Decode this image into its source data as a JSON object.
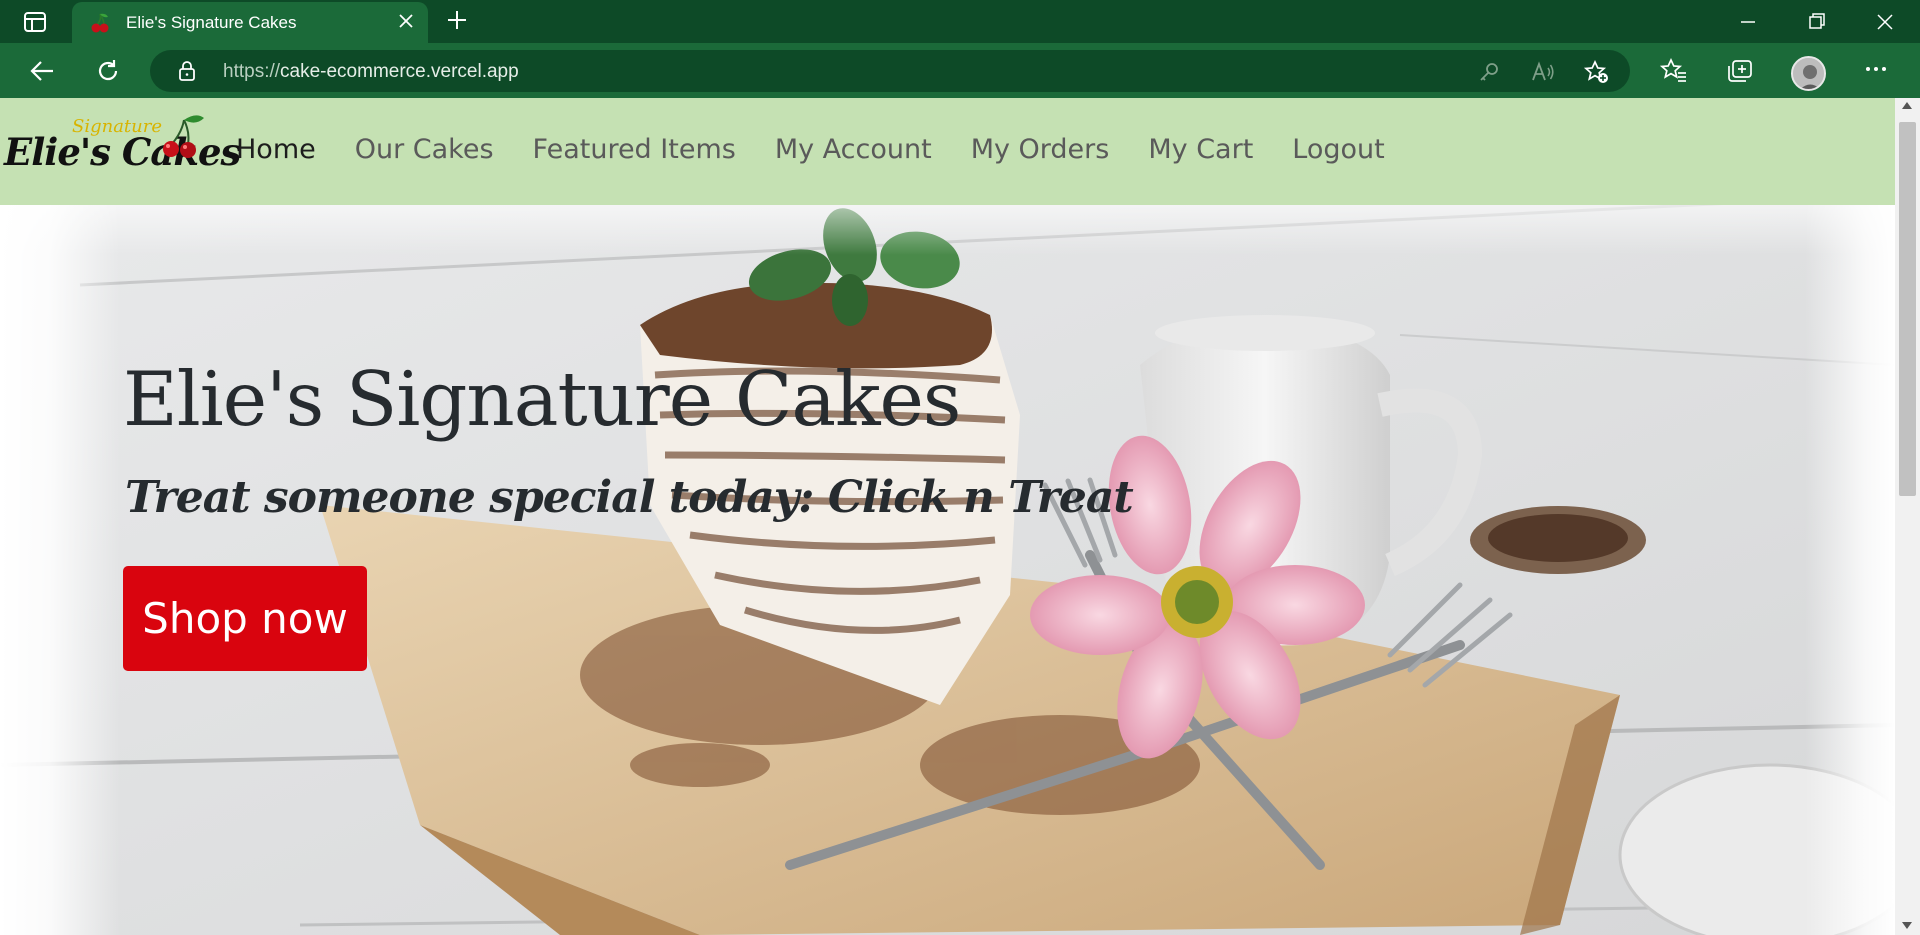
{
  "browser": {
    "tab_title": "Elie's Signature Cakes",
    "url_protocol": "https://",
    "url_host": "cake-ecommerce.vercel.app",
    "icons": {
      "tab_actions": "tab-actions-icon",
      "favicon": "cherry-icon",
      "tab_close": "close-icon",
      "new_tab": "plus-icon",
      "minimize": "minimize-icon",
      "maximize": "restore-icon",
      "close": "close-icon",
      "back": "back-arrow-icon",
      "reload": "reload-icon",
      "lock": "lock-icon",
      "password": "key-icon",
      "read_aloud": "read-aloud-icon",
      "add_favorite": "star-add-icon",
      "favorites": "favorites-icon",
      "collections": "collections-icon",
      "profile": "avatar-icon",
      "more": "more-icon"
    },
    "colors": {
      "tabbar": "#0d4a27",
      "toolbar": "#1b6a39"
    }
  },
  "site": {
    "logo": {
      "signature_text": "Signature",
      "brand_text": "Elie's Cakes"
    },
    "nav": {
      "items": [
        {
          "label": "Home",
          "active": true
        },
        {
          "label": "Our Cakes",
          "active": false
        },
        {
          "label": "Featured Items",
          "active": false
        },
        {
          "label": "My Account",
          "active": false
        },
        {
          "label": "My Orders",
          "active": false
        },
        {
          "label": "My Cart",
          "active": false
        },
        {
          "label": "Logout",
          "active": false
        }
      ]
    },
    "hero": {
      "title": "Elie's Signature Cakes",
      "subtitle": "Treat someone special today: Click n Treat",
      "cta_label": "Shop now"
    },
    "colors": {
      "navbar": "#c5e1b3",
      "cta": "#d9040e",
      "text": "#262b2f"
    }
  }
}
